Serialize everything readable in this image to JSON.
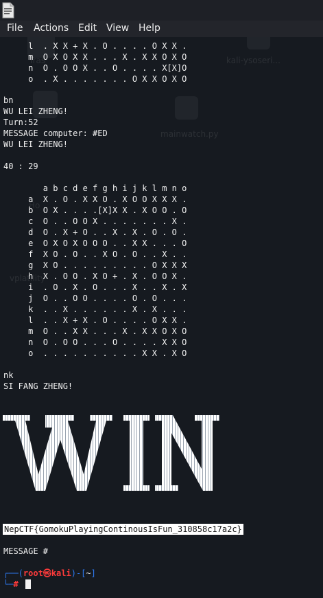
{
  "menu": {
    "file": "File",
    "actions": "Actions",
    "edit": "Edit",
    "view": "View",
    "help": "Help"
  },
  "watermarks": {
    "trash": "Tras",
    "kali": "kali-ysoseri...",
    "mainwatch": "mainwatch.py",
    "home": "Ho",
    "volatility": "vplatility"
  },
  "terminal": {
    "top_board_rows": [
      "     l  . X X + X . O . . . . O X X .",
      "     m  O X O X X . . . X . X X O X O",
      "     n  O . O O X . . O . . . . X[X]O",
      "     o  . X . . . . . . . O X X O X O"
    ],
    "move_cmd": "bn",
    "player_line": "WU LEI ZHENG!",
    "turn_line": "Turn:52",
    "message_line": "MESSAGE computer: #ED",
    "player_line_2": "WU LEI ZHENG!",
    "score_line": "40 : 29",
    "board_header": "        a b c d e f g h i j k l m n o",
    "board_rows": [
      "     a  X . O . X X O . X O O X X X .",
      "     b  O X . . . .[X]X X . X O O . O",
      "     c  O . . O O X . . . . . . . X .",
      "     d  O . X + O . . X . X . O . O .",
      "     e  O X O X O O O . . X X . . . O",
      "     f  X O . O . . X O . O . . X . .",
      "     g  X O . . . . . . . . . O X X X",
      "     h  X . O O . X O + . X . O O X .",
      "     i  . O . X . O . . . X . . X . X",
      "     j  O . . O O . . . . O . O . . .",
      "     k  . . X . . . . . . X . X . . .",
      "     l  . . X + X . O . . . . O X X .",
      "     m  O . . X X . . . X . X X O X O",
      "     n  O . O O . . . O . . . . X X O",
      "     o  . . . . . . . . . . X X . X O"
    ],
    "move_cmd_2": "nk",
    "winner_line": "SI FANG ZHENG!",
    "flag": "NepCTF{GomokuPlayingContinousIsFun_310858c17a2c}",
    "final_message": "MESSAGE #",
    "prompt_user": "root",
    "prompt_skull": "㉿",
    "prompt_host": "kali",
    "prompt_dir": "~",
    "prompt_symbol": "#"
  },
  "colors": {
    "terminal_bg": "#161a20",
    "prompt_blue": "#2e7cf6",
    "prompt_red": "#ff3b3b",
    "flag_bg": "#ffffff"
  },
  "icons": {
    "app": "terminal-app-icon",
    "win_banner": "win-ascii-art"
  }
}
